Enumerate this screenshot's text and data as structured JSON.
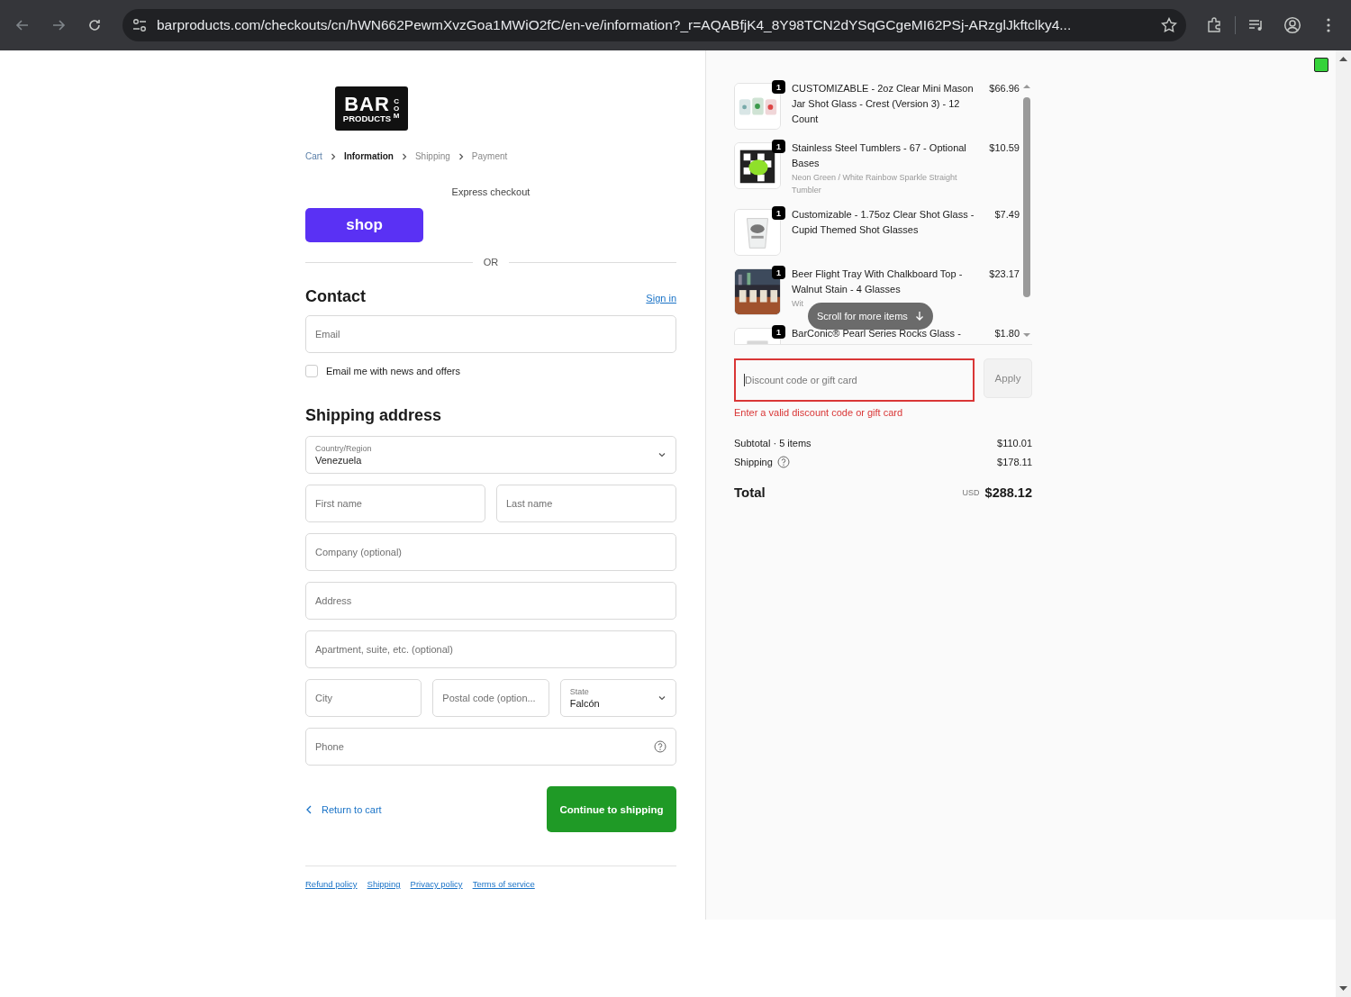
{
  "browser": {
    "url": "barproducts.com/checkouts/cn/hWN662PewmXvzGoa1MWiO2fC/en-ve/information?_r=AQABfjK4_8Y98TCN2dYSqGCgeMI62PSj-ARzglJkftclky4..."
  },
  "logo": {
    "word": "BAR",
    "sub": "PRODUCTS",
    "suffix": "COM"
  },
  "breadcrumbs": [
    {
      "label": "Cart",
      "kind": "link"
    },
    {
      "label": "Information",
      "kind": "current"
    },
    {
      "label": "Shipping",
      "kind": "pending"
    },
    {
      "label": "Payment",
      "kind": "pending"
    }
  ],
  "express": {
    "title": "Express checkout",
    "shop_button": "shop",
    "divider": "OR"
  },
  "contact": {
    "heading": "Contact",
    "sign_in": "Sign in",
    "email_placeholder": "Email",
    "newsletter": {
      "label": "Email me with news and offers",
      "checked": false
    }
  },
  "shipping": {
    "heading": "Shipping address",
    "rows": [
      [
        {
          "kind": "select",
          "label": "Country/Region",
          "value": "Venezuela"
        }
      ],
      [
        {
          "kind": "input",
          "placeholder": "First name"
        },
        {
          "kind": "input",
          "placeholder": "Last name"
        }
      ],
      [
        {
          "kind": "input",
          "placeholder": "Company (optional)"
        }
      ],
      [
        {
          "kind": "input",
          "placeholder": "Address"
        }
      ],
      [
        {
          "kind": "input",
          "placeholder": "Apartment, suite, etc. (optional)"
        }
      ],
      [
        {
          "kind": "input",
          "placeholder": "City"
        },
        {
          "kind": "input",
          "placeholder": "Postal code (option..."
        },
        {
          "kind": "select",
          "label": "State",
          "value": "Falcón"
        }
      ],
      [
        {
          "kind": "help",
          "placeholder": "Phone"
        }
      ]
    ]
  },
  "actions": {
    "back": "Return to cart",
    "continue": "Continue to shipping"
  },
  "footer_links": [
    "Refund policy",
    "Shipping",
    "Privacy policy",
    "Terms of service"
  ],
  "order": {
    "items": [
      {
        "title": "CUSTOMIZABLE - 2oz Clear Mini Mason Jar Shot Glass - Crest (Version 3) - 12 Count",
        "quantity": "1",
        "price": "$66.96"
      },
      {
        "title": "Stainless Steel Tumblers - 67 - Optional Bases",
        "variant": "Neon Green / White Rainbow Sparkle Straight Tumbler",
        "quantity": "1",
        "price": "$10.59"
      },
      {
        "title": "Customizable - 1.75oz Clear Shot Glass - Cupid Themed Shot Glasses",
        "quantity": "1",
        "price": "$7.49"
      },
      {
        "title": "Beer Flight Tray With Chalkboard Top - Walnut Stain - 4 Glasses",
        "variant": "Wit",
        "quantity": "1",
        "price": "$23.17"
      },
      {
        "title": "BarConic® Pearl Series Rocks Glass -",
        "quantity": "1",
        "price": "$1.80"
      }
    ],
    "scroll_hint": "Scroll for more items",
    "discount": {
      "placeholder": "Discount code or gift card",
      "apply": "Apply",
      "error": "Enter a valid discount code or gift card"
    },
    "subtotal": {
      "label": "Subtotal · 5 items",
      "value": "$110.01"
    },
    "shipping": {
      "label": "Shipping",
      "value": "$178.11"
    },
    "total": {
      "label": "Total",
      "currency": "USD",
      "value": "$288.12"
    }
  }
}
